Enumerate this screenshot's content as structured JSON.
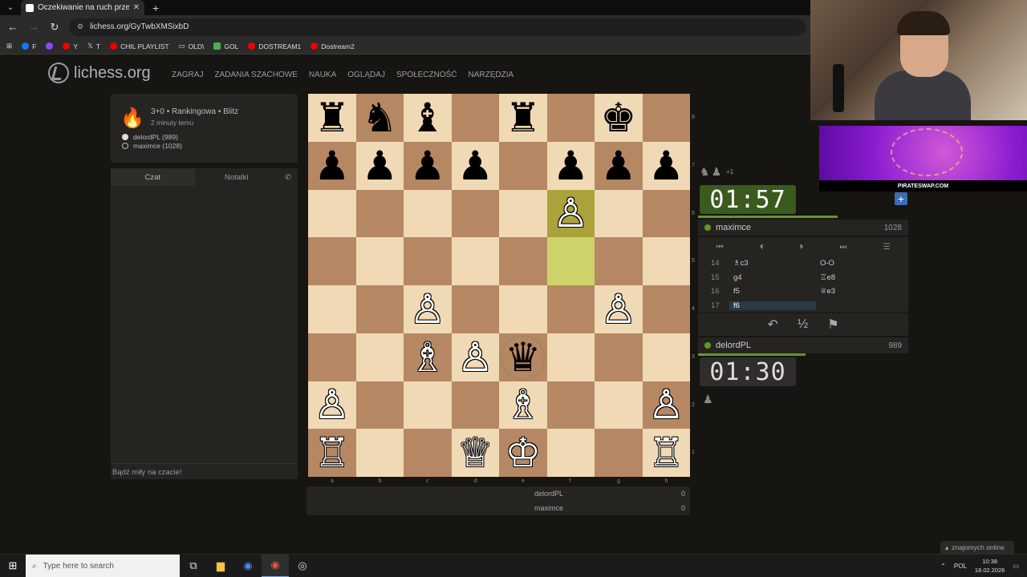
{
  "browser": {
    "tab_title": "Oczekiwanie na ruch przeciwnika",
    "url": "lichess.org/GyTwbXMSixbD",
    "bookmarks": [
      "F",
      "Y",
      "T",
      "CHIL PLAYLIST",
      "OLD\\",
      "GOL",
      "DOSTREAM1",
      "Dostream2"
    ]
  },
  "site": {
    "logo": "lichess.org",
    "nav": [
      "ZAGRAJ",
      "ZADANIA SZACHOWE",
      "NAUKA",
      "OGLĄDAJ",
      "SPOŁECZNOŚĆ",
      "NARZĘDZIA"
    ]
  },
  "game_info": {
    "title": "3+0 • Rankingowa • Blitz",
    "subtitle": "2 minuty temu",
    "white": "delordPL (989)",
    "black": "maximce (1028)"
  },
  "chat": {
    "tab_chat": "Czat",
    "tab_notes": "Notatki",
    "placeholder": "Bądź miły na czacie!"
  },
  "board": {
    "files": [
      "a",
      "b",
      "c",
      "d",
      "e",
      "f",
      "g",
      "h"
    ],
    "ranks": [
      "8",
      "7",
      "6",
      "5",
      "4",
      "3",
      "2",
      "1"
    ],
    "pieces": [
      {
        "sq": "a8",
        "glyph": "♜",
        "color": "black",
        "name": "black-rook"
      },
      {
        "sq": "b8",
        "glyph": "♞",
        "color": "black",
        "name": "black-knight"
      },
      {
        "sq": "c8",
        "glyph": "♝",
        "color": "black",
        "name": "black-bishop"
      },
      {
        "sq": "e8",
        "glyph": "♜",
        "color": "black",
        "name": "black-rook"
      },
      {
        "sq": "g8",
        "glyph": "♚",
        "color": "black",
        "name": "black-king"
      },
      {
        "sq": "a7",
        "glyph": "♟",
        "color": "black",
        "name": "black-pawn"
      },
      {
        "sq": "b7",
        "glyph": "♟",
        "color": "black",
        "name": "black-pawn"
      },
      {
        "sq": "c7",
        "glyph": "♟",
        "color": "black",
        "name": "black-pawn"
      },
      {
        "sq": "d7",
        "glyph": "♟",
        "color": "black",
        "name": "black-pawn"
      },
      {
        "sq": "f7",
        "glyph": "♟",
        "color": "black",
        "name": "black-pawn"
      },
      {
        "sq": "g7",
        "glyph": "♟",
        "color": "black",
        "name": "black-pawn"
      },
      {
        "sq": "h7",
        "glyph": "♟",
        "color": "black",
        "name": "black-pawn"
      },
      {
        "sq": "f6",
        "glyph": "♙",
        "color": "white",
        "name": "white-pawn"
      },
      {
        "sq": "c4",
        "glyph": "♙",
        "color": "white",
        "name": "white-pawn"
      },
      {
        "sq": "g4",
        "glyph": "♙",
        "color": "white",
        "name": "white-pawn"
      },
      {
        "sq": "c3",
        "glyph": "♗",
        "color": "white",
        "name": "white-bishop"
      },
      {
        "sq": "d3",
        "glyph": "♙",
        "color": "white",
        "name": "white-pawn"
      },
      {
        "sq": "e3",
        "glyph": "♛",
        "color": "black",
        "name": "black-queen"
      },
      {
        "sq": "a2",
        "glyph": "♙",
        "color": "white",
        "name": "white-pawn"
      },
      {
        "sq": "e2",
        "glyph": "♗",
        "color": "white",
        "name": "white-bishop"
      },
      {
        "sq": "h2",
        "glyph": "♙",
        "color": "white",
        "name": "white-pawn"
      },
      {
        "sq": "a1",
        "glyph": "♖",
        "color": "white",
        "name": "white-rook"
      },
      {
        "sq": "d1",
        "glyph": "♕",
        "color": "white",
        "name": "white-queen"
      },
      {
        "sq": "e1",
        "glyph": "♔",
        "color": "white",
        "name": "white-king"
      },
      {
        "sq": "h1",
        "glyph": "♖",
        "color": "white",
        "name": "white-rook"
      }
    ],
    "last_move": [
      "f5",
      "f6"
    ]
  },
  "crosstable": {
    "p1": "delordPL",
    "p1_score": "0",
    "p2": "maximce",
    "p2_score": "0"
  },
  "right_panel": {
    "captured_extra": "+1",
    "top_clock": "01:57",
    "top_player": "maximce",
    "top_rating": "1028",
    "moves": [
      {
        "num": "14",
        "white": "♗c3",
        "black": "O-O"
      },
      {
        "num": "15",
        "white": "g4",
        "black": "♖e8"
      },
      {
        "num": "16",
        "white": "f5",
        "black": "♕e3"
      },
      {
        "num": "17",
        "white": "f6",
        "black": ""
      }
    ],
    "bottom_player": "delordPL",
    "bottom_rating": "989",
    "bottom_clock": "01:30",
    "draw_symbol": "½"
  },
  "stream": {
    "sponsor": "PIRATESWAP.COM"
  },
  "friends": "znajomych online",
  "taskbar": {
    "search_placeholder": "Type here to search",
    "lang": "POL",
    "time": "10:38",
    "date": "18.02.2026"
  },
  "colors": {
    "board_light": "#f0d9b5",
    "board_dark": "#b58863",
    "highlight": "#cdd26a",
    "active_clock": "#3a5a1e"
  }
}
